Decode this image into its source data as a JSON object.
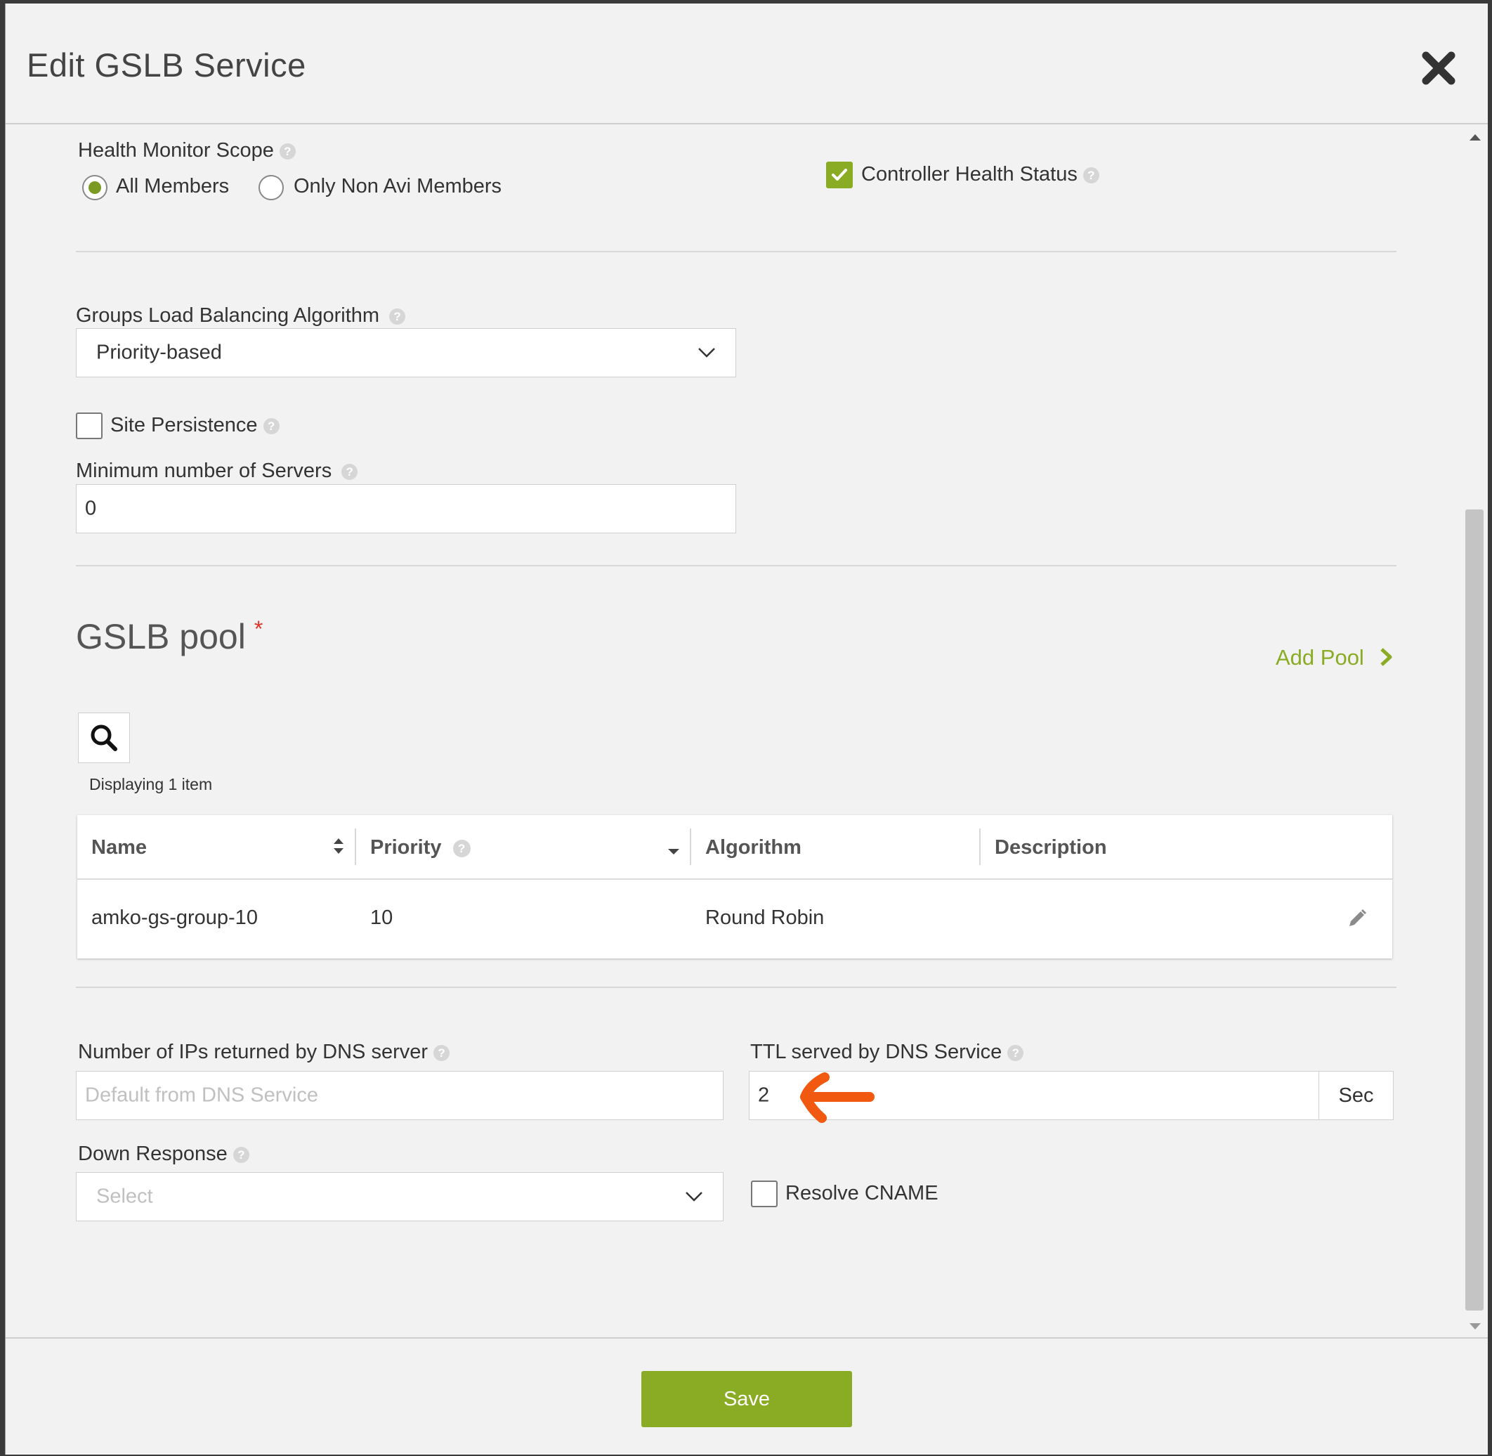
{
  "modal": {
    "title": "Edit GSLB Service"
  },
  "health_monitor": {
    "label": "Health Monitor Scope",
    "options": [
      "All Members",
      "Only Non Avi Members"
    ],
    "selected": "All Members",
    "controller_health_label": "Controller Health Status",
    "controller_health_checked": true
  },
  "groups_lb": {
    "label": "Groups Load Balancing Algorithm",
    "value": "Priority-based"
  },
  "site_persistence": {
    "label": "Site Persistence",
    "checked": false
  },
  "min_servers": {
    "label": "Minimum number of Servers",
    "value": "0"
  },
  "gslb_pool": {
    "title": "GSLB pool",
    "required_mark": "*",
    "add_pool_label": "Add Pool",
    "displaying": "Displaying 1 item",
    "columns": [
      "Name",
      "Priority",
      "Algorithm",
      "Description"
    ],
    "rows": [
      {
        "name": "amko-gs-group-10",
        "priority": "10",
        "algorithm": "Round Robin",
        "description": ""
      }
    ]
  },
  "dns": {
    "num_ips_label": "Number of IPs returned by DNS server",
    "num_ips_placeholder": "Default from DNS Service",
    "ttl_label": "TTL served by DNS Service",
    "ttl_value": "2",
    "ttl_unit": "Sec",
    "down_response_label": "Down Response",
    "down_response_placeholder": "Select",
    "resolve_cname_label": "Resolve CNAME",
    "resolve_cname_checked": false
  },
  "footer": {
    "save_label": "Save"
  },
  "colors": {
    "accent": "#8aac24",
    "annotation_arrow": "#f0590f",
    "required": "#e0332b"
  },
  "icons": [
    "close-icon",
    "help-icon",
    "checkmark-icon",
    "chevron-down-icon",
    "chevron-right-icon",
    "search-icon",
    "sort-icon",
    "pencil-icon",
    "arrow-annotation-icon"
  ]
}
